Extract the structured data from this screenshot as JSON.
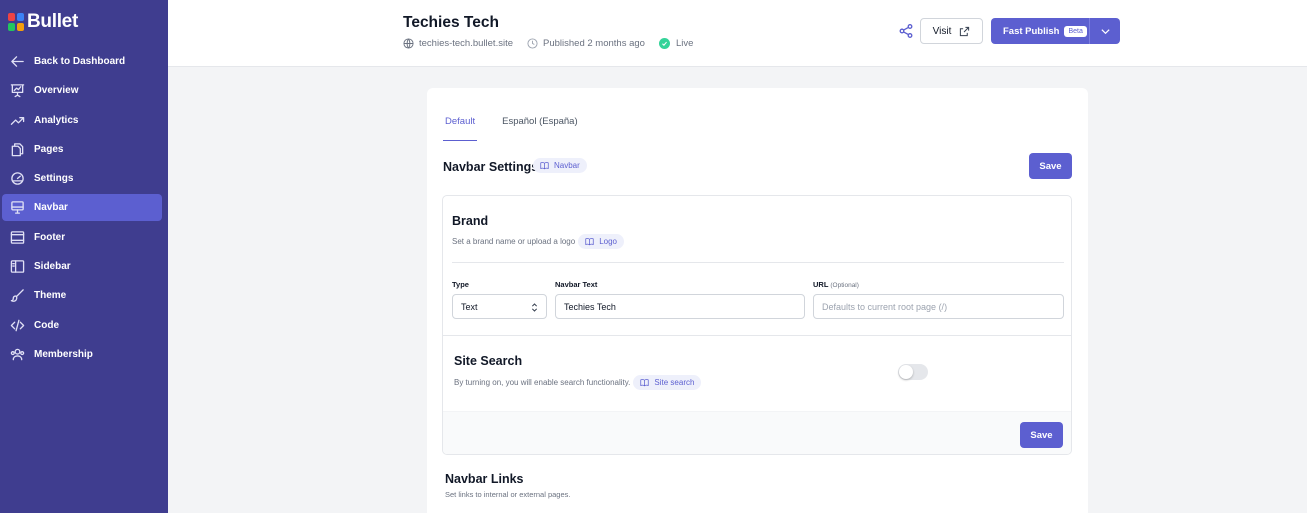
{
  "app": {
    "name": "Bullet",
    "logo_colors": [
      "#ef4444",
      "#3b82f6",
      "#22c55e",
      "#f59e0b"
    ],
    "accent": "#5c5fd0",
    "sidebar_bg": "#3f3d8f"
  },
  "sidebar": {
    "items": [
      {
        "label": "Back to Dashboard",
        "icon": "arrow-left-icon"
      },
      {
        "label": "Overview",
        "icon": "presentation-chart-icon"
      },
      {
        "label": "Analytics",
        "icon": "trending-up-icon"
      },
      {
        "label": "Pages",
        "icon": "documents-icon"
      },
      {
        "label": "Settings",
        "icon": "gauge-icon"
      },
      {
        "label": "Navbar",
        "icon": "desktop-icon",
        "active": true
      },
      {
        "label": "Footer",
        "icon": "window-footer-icon"
      },
      {
        "label": "Sidebar",
        "icon": "sidebar-layout-icon"
      },
      {
        "label": "Theme",
        "icon": "paintbrush-icon"
      },
      {
        "label": "Code",
        "icon": "code-icon"
      },
      {
        "label": "Membership",
        "icon": "users-icon"
      }
    ]
  },
  "header": {
    "title": "Techies Tech",
    "domain": "techies-tech.bullet.site",
    "published": "Published 2 months ago",
    "status": "Live",
    "visit_label": "Visit",
    "publish_label": "Fast Publish",
    "beta_label": "Beta"
  },
  "main": {
    "tabs": [
      {
        "label": "Default",
        "active": true
      },
      {
        "label": "Español (España)",
        "active": false
      }
    ],
    "section_title": "Navbar Settings",
    "section_pill": "Navbar",
    "save_label": "Save",
    "brand": {
      "title": "Brand",
      "subtitle": "Set a brand name or upload a logo",
      "pill": "Logo",
      "type_label": "Type",
      "type_value": "Text",
      "navbar_text_label": "Navbar Text",
      "navbar_text_value": "Techies Tech",
      "url_label": "URL",
      "url_optional": "(Optional)",
      "url_placeholder": "Defaults to current root page (/)"
    },
    "site_search": {
      "title": "Site Search",
      "subtitle": "By turning on, you will enable search functionality.",
      "pill": "Site search",
      "enabled": false
    },
    "save_bottom_label": "Save",
    "links": {
      "title": "Navbar Links",
      "subtitle": "Set links to internal or external pages."
    }
  }
}
